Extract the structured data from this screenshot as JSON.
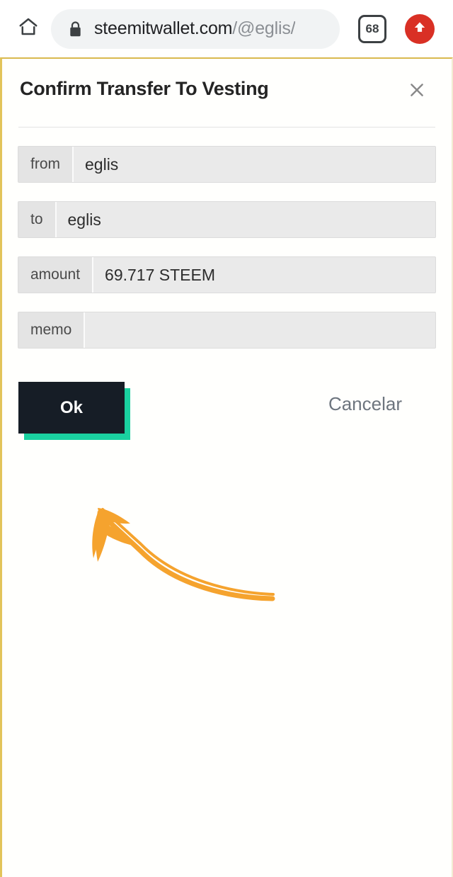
{
  "browser": {
    "home_icon": "home-icon",
    "lock_icon": "lock-icon",
    "url_host": "steemitwallet.com",
    "url_path": "/@eglis/",
    "tab_count": "68",
    "menu_icon": "up-arrow-icon"
  },
  "modal": {
    "title": "Confirm Transfer To Vesting",
    "close_icon": "close-icon",
    "fields": [
      {
        "label": "from",
        "value": "eglis"
      },
      {
        "label": "to",
        "value": "eglis"
      },
      {
        "label": "amount",
        "value": "69.717 STEEM"
      },
      {
        "label": "memo",
        "value": ""
      }
    ],
    "ok_label": "Ok",
    "cancel_label": "Cancelar"
  },
  "annotation": {
    "name": "hand-drawn-arrow",
    "color": "#f5a32e",
    "points_to": "ok-button"
  },
  "colors": {
    "accent_teal": "#1ad1a0",
    "button_dark": "#161d26",
    "annotation_orange": "#f5a32e",
    "page_border_gold": "#e2c45a",
    "menu_red": "#d93025"
  }
}
